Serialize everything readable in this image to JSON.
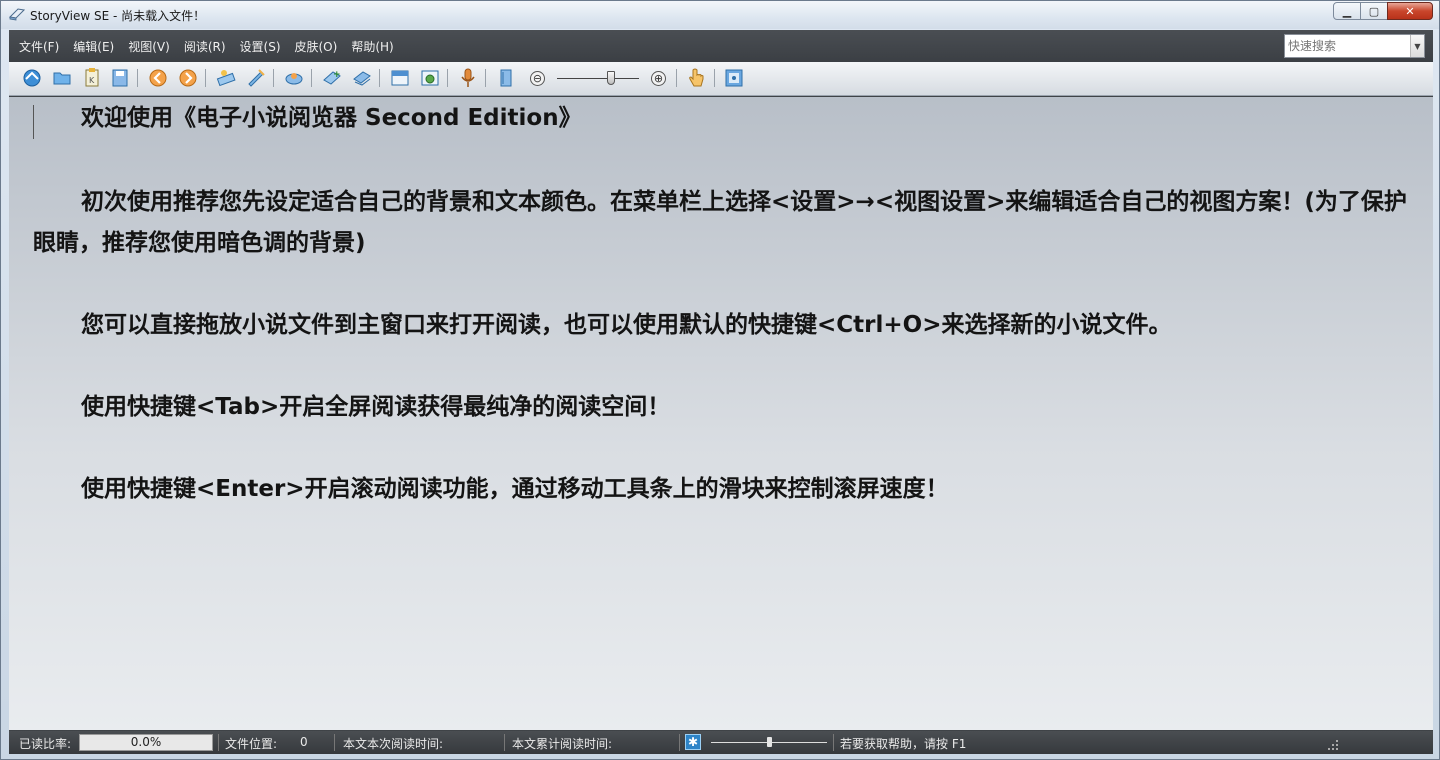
{
  "window": {
    "title": "StoryView SE - 尚未载入文件！"
  },
  "menu": {
    "items": [
      "文件(F)",
      "编辑(E)",
      "视图(V)",
      "阅读(R)",
      "设置(S)",
      "皮肤(O)",
      "帮助(H)"
    ]
  },
  "search": {
    "placeholder": "快速搜索"
  },
  "toolbar": {
    "zoom_out_label": "⊖",
    "zoom_in_label": "⊕",
    "zoom_level_fraction": 0.66
  },
  "content": {
    "paragraphs": [
      "欢迎使用《电子小说阅览器 Second Edition》",
      "初次使用推荐您先设定适合自己的背景和文本颜色。在菜单栏上选择<设置>→<视图设置>来编辑适合自己的视图方案！(为了保护眼睛，推荐您使用暗色调的背景)",
      "您可以直接拖放小说文件到主窗口来打开阅读，也可以使用默认的快捷键<Ctrl+O>来选择新的小说文件。",
      "使用快捷键<Tab>开启全屏阅读获得最纯净的阅读空间！",
      "使用快捷键<Enter>开启滚动阅读功能，通过移动工具条上的滑块来控制滚屏速度！"
    ]
  },
  "status": {
    "read_ratio_label": "已读比率:",
    "read_ratio_value": "0.0%",
    "file_position_label": "文件位置:",
    "file_position_value": "0",
    "session_time_label": "本文本次阅读时间:",
    "total_time_label": "本文累计阅读时间:",
    "scroll_speed_fraction": 0.5,
    "help_text": "若要获取帮助，请按 F1"
  },
  "colors": {
    "accent_close": "#c9462c",
    "frame_dark": "#3f4347",
    "status_icon": "#2d84c8"
  }
}
